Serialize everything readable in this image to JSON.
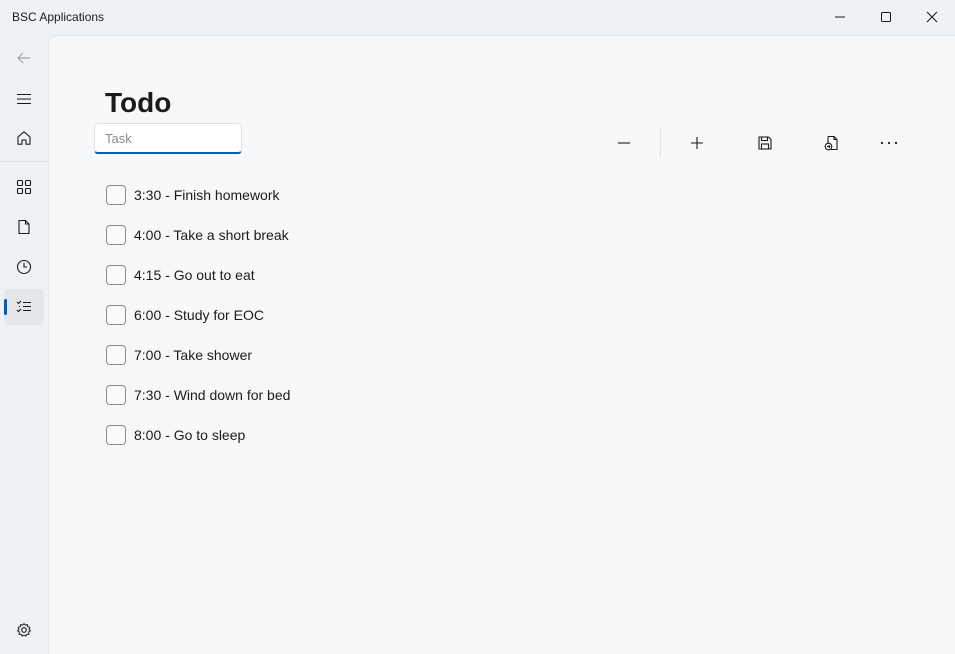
{
  "window": {
    "title": "BSC Applications",
    "controls": [
      {
        "name": "minimize",
        "icon": "minimize-icon"
      },
      {
        "name": "maximize",
        "icon": "maximize-icon"
      },
      {
        "name": "close",
        "icon": "close-icon"
      }
    ]
  },
  "nav": {
    "items": [
      {
        "name": "back",
        "icon": "back-arrow-icon",
        "enabled": false
      },
      {
        "name": "menu",
        "icon": "hamburger-menu-icon"
      },
      {
        "name": "home",
        "icon": "home-icon"
      },
      {
        "name": "apps",
        "icon": "apps-grid-icon"
      },
      {
        "name": "documents",
        "icon": "document-icon"
      },
      {
        "name": "history",
        "icon": "clock-icon"
      },
      {
        "name": "todo",
        "icon": "checklist-icon",
        "selected": true
      },
      {
        "name": "settings",
        "icon": "gear-icon"
      }
    ],
    "accent": "#005fb8"
  },
  "page": {
    "title": "Todo",
    "task_input": {
      "placeholder": "Task",
      "value": ""
    },
    "commands": [
      {
        "name": "remove",
        "icon": "minus-icon"
      },
      {
        "name": "add",
        "icon": "plus-icon"
      },
      {
        "name": "save",
        "icon": "save-icon"
      },
      {
        "name": "open",
        "icon": "open-file-icon"
      },
      {
        "name": "more",
        "icon": "more-icon"
      }
    ],
    "todos": [
      {
        "text": "3:30 - Finish homework",
        "checked": false
      },
      {
        "text": "4:00 - Take a short break",
        "checked": false
      },
      {
        "text": "4:15 - Go out to eat",
        "checked": false
      },
      {
        "text": "6:00 - Study for EOC",
        "checked": false
      },
      {
        "text": "7:00 - Take shower",
        "checked": false
      },
      {
        "text": "7:30 - Wind down for bed",
        "checked": false
      },
      {
        "text": "8:00 - Go to sleep",
        "checked": false
      }
    ]
  }
}
